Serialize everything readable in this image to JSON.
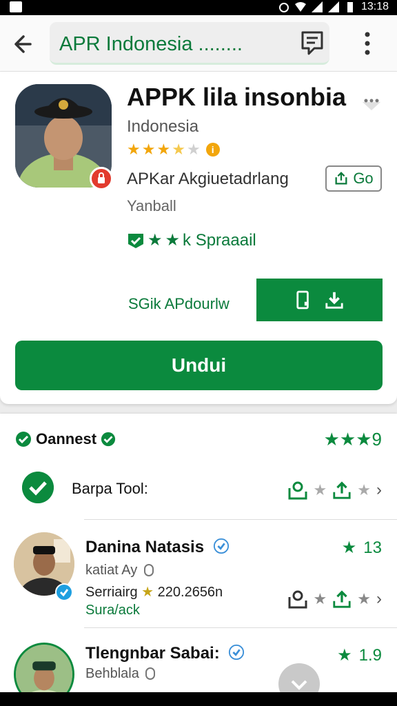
{
  "status_bar": {
    "time": "13:18"
  },
  "search": {
    "query": "APR Indonesia ........"
  },
  "app": {
    "title": "APPK lila insonbia",
    "subtitle": "Indonesia",
    "rating_stars": 3.5,
    "developer": "APKar Akgiuetadrlang",
    "go_label": "Go",
    "category": "Yanball",
    "verified_label": "k Spraaail",
    "size_text": "SGik APdourlw",
    "install_label": "Undui"
  },
  "colors": {
    "accent": "#0b8a3e",
    "star": "#f2a60c"
  },
  "section": {
    "title": "Oannest",
    "rating": "9",
    "first_row_label": "Barpa Tool:"
  },
  "reviews": [
    {
      "name": "Danina Natasis",
      "meta": "katiat Ay",
      "date": "Serriairg",
      "rating_text": "220.2656n",
      "tag": "Sura/ack",
      "score": "13"
    },
    {
      "name": "Tlengnbar Sabai:",
      "meta": "Behblala",
      "score": "1.9"
    }
  ]
}
